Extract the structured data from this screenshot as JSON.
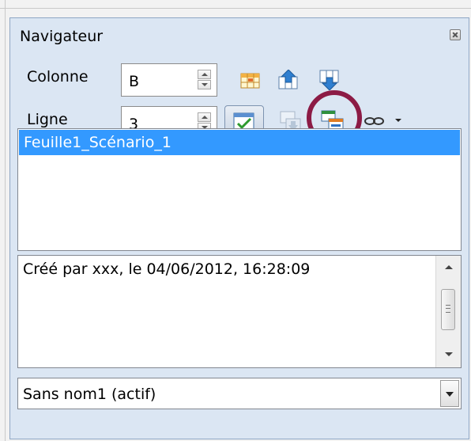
{
  "window": {
    "title": "Navigateur"
  },
  "fields": {
    "column": {
      "label": "Colonne",
      "value": "B"
    },
    "row": {
      "label": "Ligne",
      "value": "3"
    }
  },
  "scenarios": {
    "items": [
      "Feuille1_Scénario_1"
    ],
    "selected_index": 0
  },
  "description": {
    "text": "Créé par xxx, le 04/06/2012, 16:28:09"
  },
  "document_select": {
    "value": "Sans nom1 (actif)"
  },
  "colors": {
    "panel_bg": "#dbe6f3",
    "selection": "#3399ff",
    "highlight_circle": "#8c1b45"
  },
  "icons": {
    "toolbar_row1": [
      "data-range-icon",
      "start-icon",
      "end-icon"
    ],
    "toolbar_row2": [
      "contents-toggle-icon",
      "toggle-icon",
      "scenarios-icon",
      "drag-mode-icon",
      "dropdown-arrow-icon"
    ]
  }
}
